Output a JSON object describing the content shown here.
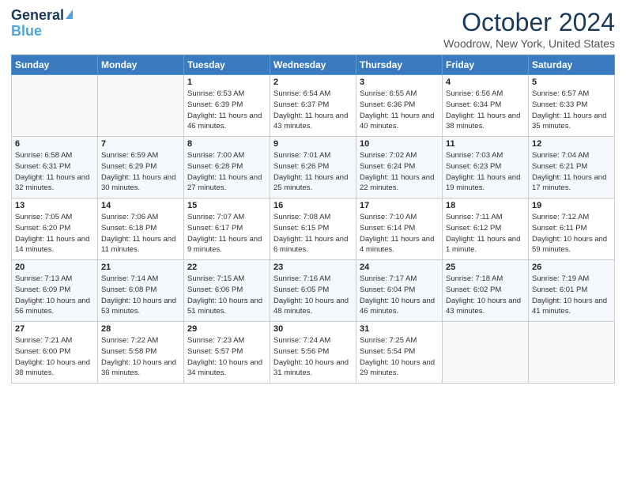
{
  "header": {
    "logo_line1": "General",
    "logo_line2": "Blue",
    "month": "October 2024",
    "location": "Woodrow, New York, United States"
  },
  "weekdays": [
    "Sunday",
    "Monday",
    "Tuesday",
    "Wednesday",
    "Thursday",
    "Friday",
    "Saturday"
  ],
  "weeks": [
    [
      null,
      null,
      {
        "day": 1,
        "sunrise": "6:53 AM",
        "sunset": "6:39 PM",
        "daylight": "11 hours and 46 minutes."
      },
      {
        "day": 2,
        "sunrise": "6:54 AM",
        "sunset": "6:37 PM",
        "daylight": "11 hours and 43 minutes."
      },
      {
        "day": 3,
        "sunrise": "6:55 AM",
        "sunset": "6:36 PM",
        "daylight": "11 hours and 40 minutes."
      },
      {
        "day": 4,
        "sunrise": "6:56 AM",
        "sunset": "6:34 PM",
        "daylight": "11 hours and 38 minutes."
      },
      {
        "day": 5,
        "sunrise": "6:57 AM",
        "sunset": "6:33 PM",
        "daylight": "11 hours and 35 minutes."
      }
    ],
    [
      {
        "day": 6,
        "sunrise": "6:58 AM",
        "sunset": "6:31 PM",
        "daylight": "11 hours and 32 minutes."
      },
      {
        "day": 7,
        "sunrise": "6:59 AM",
        "sunset": "6:29 PM",
        "daylight": "11 hours and 30 minutes."
      },
      {
        "day": 8,
        "sunrise": "7:00 AM",
        "sunset": "6:28 PM",
        "daylight": "11 hours and 27 minutes."
      },
      {
        "day": 9,
        "sunrise": "7:01 AM",
        "sunset": "6:26 PM",
        "daylight": "11 hours and 25 minutes."
      },
      {
        "day": 10,
        "sunrise": "7:02 AM",
        "sunset": "6:24 PM",
        "daylight": "11 hours and 22 minutes."
      },
      {
        "day": 11,
        "sunrise": "7:03 AM",
        "sunset": "6:23 PM",
        "daylight": "11 hours and 19 minutes."
      },
      {
        "day": 12,
        "sunrise": "7:04 AM",
        "sunset": "6:21 PM",
        "daylight": "11 hours and 17 minutes."
      }
    ],
    [
      {
        "day": 13,
        "sunrise": "7:05 AM",
        "sunset": "6:20 PM",
        "daylight": "11 hours and 14 minutes."
      },
      {
        "day": 14,
        "sunrise": "7:06 AM",
        "sunset": "6:18 PM",
        "daylight": "11 hours and 11 minutes."
      },
      {
        "day": 15,
        "sunrise": "7:07 AM",
        "sunset": "6:17 PM",
        "daylight": "11 hours and 9 minutes."
      },
      {
        "day": 16,
        "sunrise": "7:08 AM",
        "sunset": "6:15 PM",
        "daylight": "11 hours and 6 minutes."
      },
      {
        "day": 17,
        "sunrise": "7:10 AM",
        "sunset": "6:14 PM",
        "daylight": "11 hours and 4 minutes."
      },
      {
        "day": 18,
        "sunrise": "7:11 AM",
        "sunset": "6:12 PM",
        "daylight": "11 hours and 1 minute."
      },
      {
        "day": 19,
        "sunrise": "7:12 AM",
        "sunset": "6:11 PM",
        "daylight": "10 hours and 59 minutes."
      }
    ],
    [
      {
        "day": 20,
        "sunrise": "7:13 AM",
        "sunset": "6:09 PM",
        "daylight": "10 hours and 56 minutes."
      },
      {
        "day": 21,
        "sunrise": "7:14 AM",
        "sunset": "6:08 PM",
        "daylight": "10 hours and 53 minutes."
      },
      {
        "day": 22,
        "sunrise": "7:15 AM",
        "sunset": "6:06 PM",
        "daylight": "10 hours and 51 minutes."
      },
      {
        "day": 23,
        "sunrise": "7:16 AM",
        "sunset": "6:05 PM",
        "daylight": "10 hours and 48 minutes."
      },
      {
        "day": 24,
        "sunrise": "7:17 AM",
        "sunset": "6:04 PM",
        "daylight": "10 hours and 46 minutes."
      },
      {
        "day": 25,
        "sunrise": "7:18 AM",
        "sunset": "6:02 PM",
        "daylight": "10 hours and 43 minutes."
      },
      {
        "day": 26,
        "sunrise": "7:19 AM",
        "sunset": "6:01 PM",
        "daylight": "10 hours and 41 minutes."
      }
    ],
    [
      {
        "day": 27,
        "sunrise": "7:21 AM",
        "sunset": "6:00 PM",
        "daylight": "10 hours and 38 minutes."
      },
      {
        "day": 28,
        "sunrise": "7:22 AM",
        "sunset": "5:58 PM",
        "daylight": "10 hours and 36 minutes."
      },
      {
        "day": 29,
        "sunrise": "7:23 AM",
        "sunset": "5:57 PM",
        "daylight": "10 hours and 34 minutes."
      },
      {
        "day": 30,
        "sunrise": "7:24 AM",
        "sunset": "5:56 PM",
        "daylight": "10 hours and 31 minutes."
      },
      {
        "day": 31,
        "sunrise": "7:25 AM",
        "sunset": "5:54 PM",
        "daylight": "10 hours and 29 minutes."
      },
      null,
      null
    ]
  ],
  "labels": {
    "sunrise_prefix": "Sunrise: ",
    "sunset_prefix": "Sunset: ",
    "daylight_prefix": "Daylight: "
  }
}
